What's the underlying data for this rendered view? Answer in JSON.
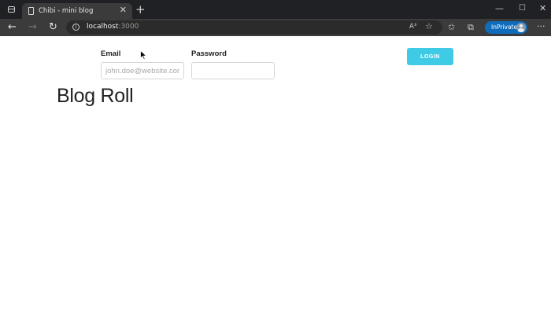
{
  "browser": {
    "tab_title": "Chibi - mini blog",
    "url_host": "localhost",
    "url_port": ":3000",
    "inprivate_label": "InPrivate",
    "read_aloud_label": "A³"
  },
  "login_form": {
    "email_label": "Email",
    "email_placeholder": "john.doe@website.com",
    "email_value": "",
    "password_label": "Password",
    "password_value": "",
    "login_label": "LOGIN"
  },
  "page": {
    "title": "Blog Roll"
  },
  "colors": {
    "login_button": "#3fcbe6",
    "inprivate_badge": "#0f6cbd",
    "titlebar": "#202124",
    "toolbar": "#3b3b3b"
  },
  "icons": [
    "window-icon",
    "page-icon",
    "close-icon",
    "plus-icon",
    "back-arrow-icon",
    "forward-arrow-icon",
    "refresh-icon",
    "info-icon",
    "read-aloud-icon",
    "favorite-star-icon",
    "favorites-icon",
    "collections-icon",
    "avatar",
    "more-icon",
    "cursor-icon"
  ]
}
